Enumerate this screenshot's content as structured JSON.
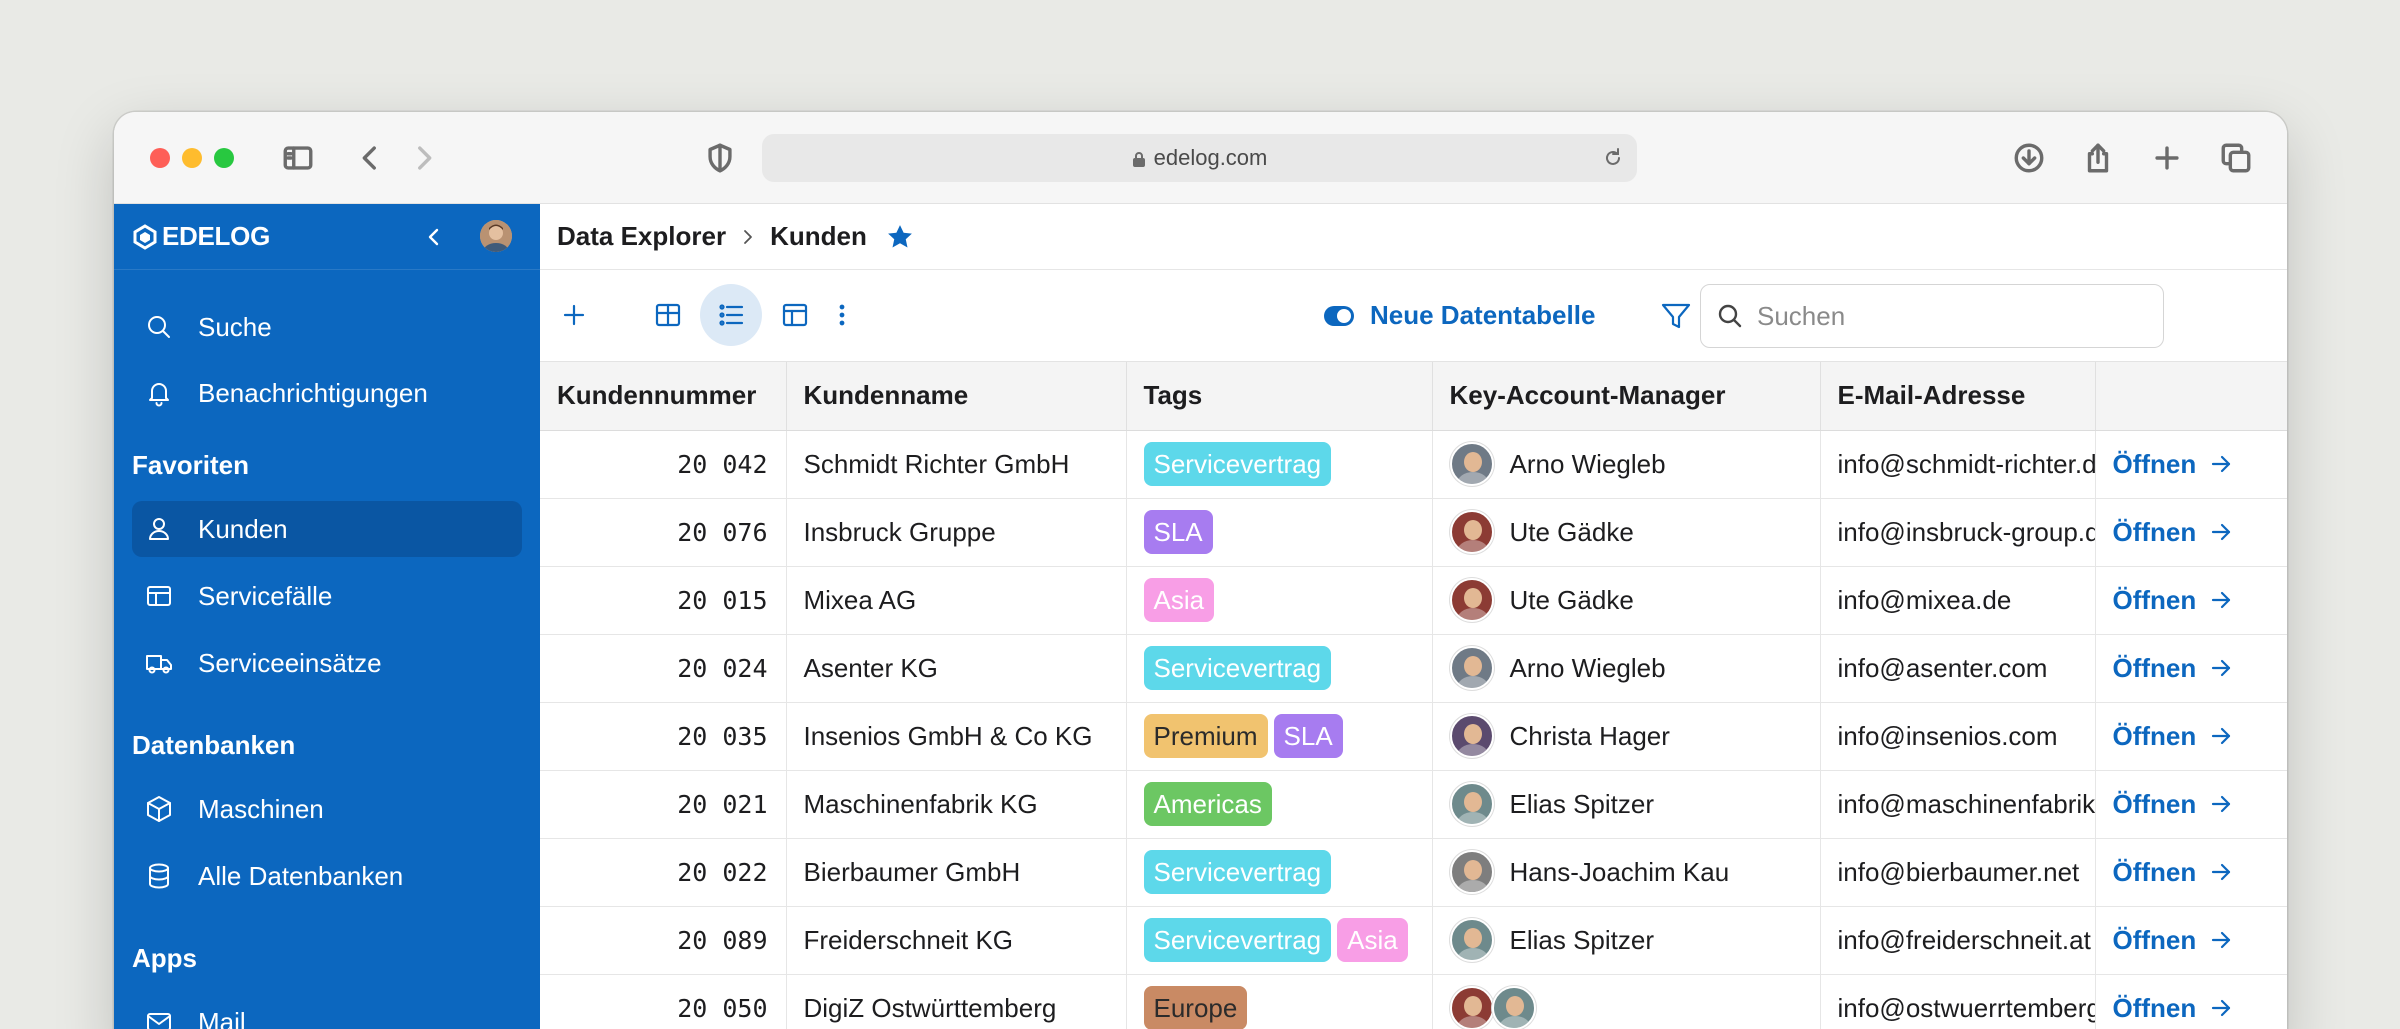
{
  "browser": {
    "url": "edelog.com"
  },
  "sidebar": {
    "logo": "EDELOG",
    "items_top": [
      {
        "label": "Suche",
        "icon": "search-icon"
      },
      {
        "label": "Benachrichtigungen",
        "icon": "bell-icon"
      }
    ],
    "section_favoriten": "Favoriten",
    "favoriten": [
      {
        "label": "Kunden",
        "icon": "person-icon",
        "active": true
      },
      {
        "label": "Servicefälle",
        "icon": "table-icon"
      },
      {
        "label": "Serviceeinsätze",
        "icon": "truck-icon"
      }
    ],
    "section_datenbanken": "Datenbanken",
    "datenbanken": [
      {
        "label": "Maschinen",
        "icon": "cube-icon"
      },
      {
        "label": "Alle Datenbanken",
        "icon": "database-icon"
      }
    ],
    "section_apps": "Apps",
    "apps": [
      {
        "label": "Mail",
        "icon": "mail-icon"
      }
    ]
  },
  "breadcrumb": {
    "parent": "Data Explorer",
    "current": "Kunden"
  },
  "toolbar": {
    "toggle_label": "Neue Datentabelle",
    "search_placeholder": "Suchen"
  },
  "table": {
    "columns": [
      "Kundennummer",
      "Kundenname",
      "Tags",
      "Key-Account-Manager",
      "E-Mail-Adresse",
      ""
    ],
    "open_label": "Öffnen",
    "rows": [
      {
        "nr": "20 042",
        "name": "Schmidt Richter GmbH",
        "tags": [
          {
            "label": "Servicevertrag",
            "color": "#5dd8ea"
          }
        ],
        "managers": [
          {
            "name": "Arno Wiegleb",
            "color": "#6f7a86"
          }
        ],
        "email": "info@schmidt-richter.de"
      },
      {
        "nr": "20 076",
        "name": "Insbruck Gruppe",
        "tags": [
          {
            "label": "SLA",
            "color": "#a77cf0"
          }
        ],
        "managers": [
          {
            "name": "Ute Gädke",
            "color": "#8c3b34"
          }
        ],
        "email": "info@insbruck-group.de"
      },
      {
        "nr": "20 015",
        "name": "Mixea AG",
        "tags": [
          {
            "label": "Asia",
            "color": "#f89ee6"
          }
        ],
        "managers": [
          {
            "name": "Ute Gädke",
            "color": "#8c3b34"
          }
        ],
        "email": "info@mixea.de"
      },
      {
        "nr": "20 024",
        "name": "Asenter KG",
        "tags": [
          {
            "label": "Servicevertrag",
            "color": "#5dd8ea"
          }
        ],
        "managers": [
          {
            "name": "Arno Wiegleb",
            "color": "#6f7a86"
          }
        ],
        "email": "info@asenter.com"
      },
      {
        "nr": "20 035",
        "name": "Insenios GmbH & Co KG",
        "tags": [
          {
            "label": "Premium",
            "color": "#f1c36f",
            "dark": true
          },
          {
            "label": "SLA",
            "color": "#a77cf0"
          }
        ],
        "managers": [
          {
            "name": "Christa Hager",
            "color": "#5b4a6e"
          }
        ],
        "email": "info@insenios.com"
      },
      {
        "nr": "20 021",
        "name": "Maschinenfabrik KG",
        "tags": [
          {
            "label": "Americas",
            "color": "#6cc763"
          }
        ],
        "managers": [
          {
            "name": "Elias Spitzer",
            "color": "#6e8a8c"
          }
        ],
        "email": "info@maschinenfabrik.de"
      },
      {
        "nr": "20 022",
        "name": "Bierbaumer GmbH",
        "tags": [
          {
            "label": "Servicevertrag",
            "color": "#5dd8ea"
          }
        ],
        "managers": [
          {
            "name": "Hans-Joachim Kau",
            "color": "#7e7e7e"
          }
        ],
        "email": "info@bierbaumer.net"
      },
      {
        "nr": "20 089",
        "name": "Freiderschneit KG",
        "tags": [
          {
            "label": "Servicevertrag",
            "color": "#5dd8ea"
          },
          {
            "label": "Asia",
            "color": "#f89ee6"
          }
        ],
        "managers": [
          {
            "name": "Elias Spitzer",
            "color": "#6e8a8c"
          }
        ],
        "email": "info@freiderschneit.at"
      },
      {
        "nr": "20 050",
        "name": "DigiZ Ostwürttemberg",
        "tags": [
          {
            "label": "Europe",
            "color": "#c98a64",
            "dark": true
          }
        ],
        "managers": [
          {
            "name": "",
            "color": "#8c3b34"
          },
          {
            "name": "",
            "color": "#6e8a8c"
          }
        ],
        "email": "info@ostwuerrtemberg.de"
      }
    ]
  }
}
